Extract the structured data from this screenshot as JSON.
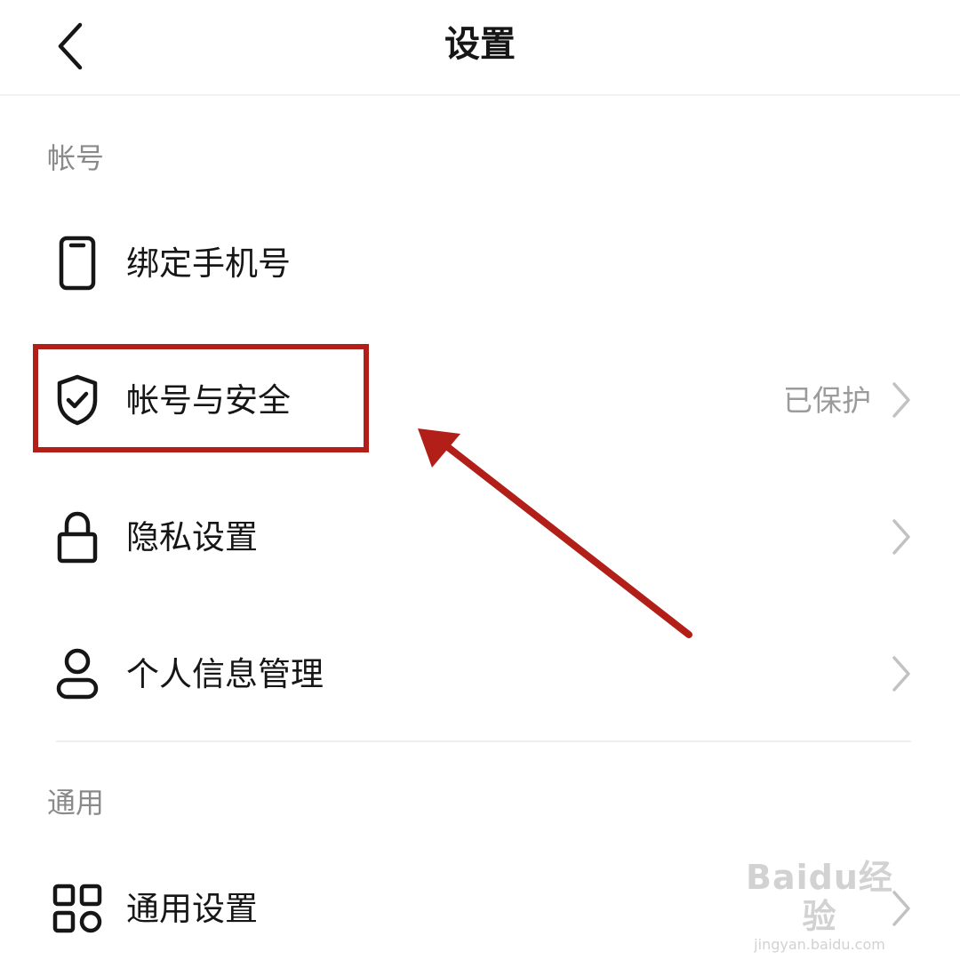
{
  "header": {
    "title": "设置",
    "back_icon": "chevron-left-icon"
  },
  "sections": [
    {
      "title": "帐号",
      "items": [
        {
          "label": "绑定手机号",
          "icon": "phone-icon"
        },
        {
          "label": "帐号与安全",
          "icon": "shield-check-icon",
          "value": "已保护",
          "highlighted": true
        },
        {
          "label": "隐私设置",
          "icon": "lock-icon"
        },
        {
          "label": "个人信息管理",
          "icon": "person-icon"
        }
      ]
    },
    {
      "title": "通用",
      "items": [
        {
          "label": "通用设置",
          "icon": "grid-icon"
        }
      ]
    }
  ],
  "annotation": {
    "color": "#b21f18"
  },
  "watermark": {
    "brand": "Baidu经验",
    "url": "jingyan.baidu.com"
  }
}
